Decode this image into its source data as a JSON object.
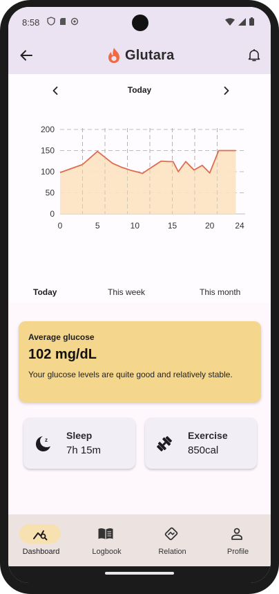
{
  "status_bar": {
    "time": "8:58"
  },
  "app_bar": {
    "title": "Glutara"
  },
  "period_nav": {
    "title": "Today"
  },
  "chart_data": {
    "type": "area",
    "x": [
      0,
      3,
      5,
      6,
      7,
      8,
      9,
      10,
      11,
      12,
      13,
      14,
      15,
      16,
      17,
      18,
      19,
      20,
      21,
      22,
      23
    ],
    "series": [
      {
        "values": [
          98,
          117,
          148,
          120,
          110,
          103,
          99,
          96,
          110,
          125,
          124,
          124,
          100,
          124,
          104,
          115,
          97,
          150,
          150
        ]
      }
    ],
    "x_points": [
      0,
      3,
      5,
      7,
      8.3,
      9.5,
      10.4,
      11,
      12.2,
      13.5,
      14.5,
      15.1,
      15.8,
      16.8,
      17.9,
      19,
      20,
      21.2,
      23.5
    ],
    "xticks": [
      "0",
      "5",
      "10",
      "15",
      "20",
      "24"
    ],
    "yticks": [
      "0",
      "50",
      "100",
      "150",
      "200"
    ],
    "xlim": [
      0,
      24
    ],
    "ylim": [
      0,
      200
    ],
    "grid": true,
    "colors": {
      "line": "#e06a4d",
      "fill": "#fde3c2"
    }
  },
  "tabs": [
    "Today",
    "This week",
    "This month"
  ],
  "average": {
    "label": "Average glucose",
    "value": "102 mg/dL",
    "description": "Your glucose levels are quite good and relatively stable."
  },
  "stats": {
    "sleep": {
      "title": "Sleep",
      "value": "7h 15m"
    },
    "exercise": {
      "title": "Exercise",
      "value": "850cal"
    }
  },
  "bottom_nav": [
    {
      "label": "Dashboard",
      "icon": "dashboard-icon"
    },
    {
      "label": "Logbook",
      "icon": "book-icon"
    },
    {
      "label": "Relation",
      "icon": "handshake-icon"
    },
    {
      "label": "Profile",
      "icon": "person-icon"
    }
  ]
}
